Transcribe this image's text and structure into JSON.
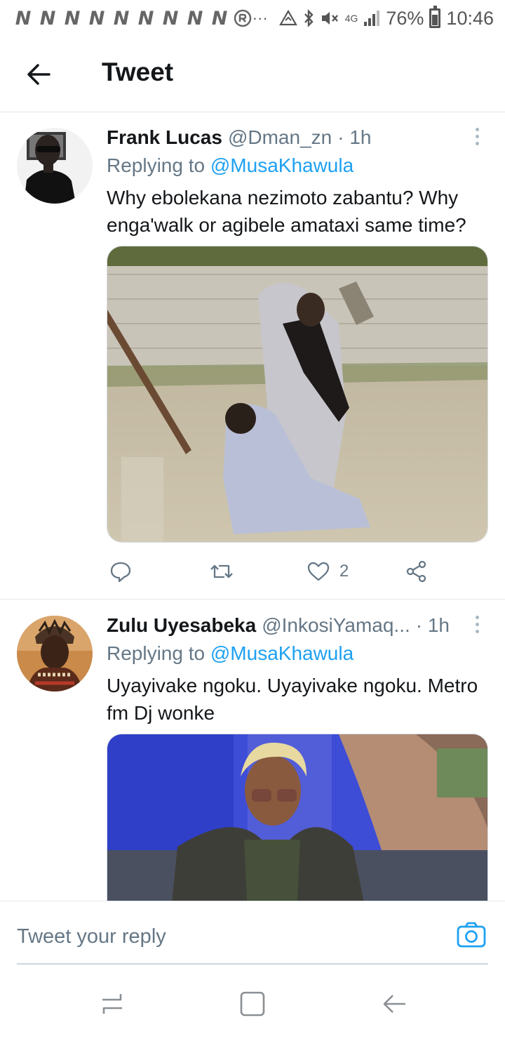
{
  "status_bar": {
    "notification_letters": [
      "N",
      "N",
      "N",
      "N",
      "N",
      "N",
      "N",
      "N",
      "N"
    ],
    "ellipsis": "···",
    "network": "4G",
    "battery": "76%",
    "time": "10:46"
  },
  "header": {
    "title": "Tweet"
  },
  "tweets": [
    {
      "display_name": "Frank Lucas",
      "handle": "@Dman_zn",
      "time": "· 1h",
      "replying_prefix": "Replying to",
      "replying_to": "@MusaKhawula",
      "text": "Why ebolekana nezimoto zabantu? Why enga'walk or agibele amataxi same time?",
      "like_count": "2"
    },
    {
      "display_name": "Zulu Uyesabeka",
      "handle": "@InkosiYamaq...",
      "time": "· 1h",
      "replying_prefix": "Replying to",
      "replying_to": "@MusaKhawula",
      "text": "Uyayivake ngoku. Uyayivake ngoku. Metro fm Dj wonke"
    }
  ],
  "composer": {
    "placeholder": "Tweet your reply"
  },
  "colors": {
    "accent": "#1da1f2",
    "secondary_text": "#657786",
    "divider": "#e1e8ed"
  }
}
